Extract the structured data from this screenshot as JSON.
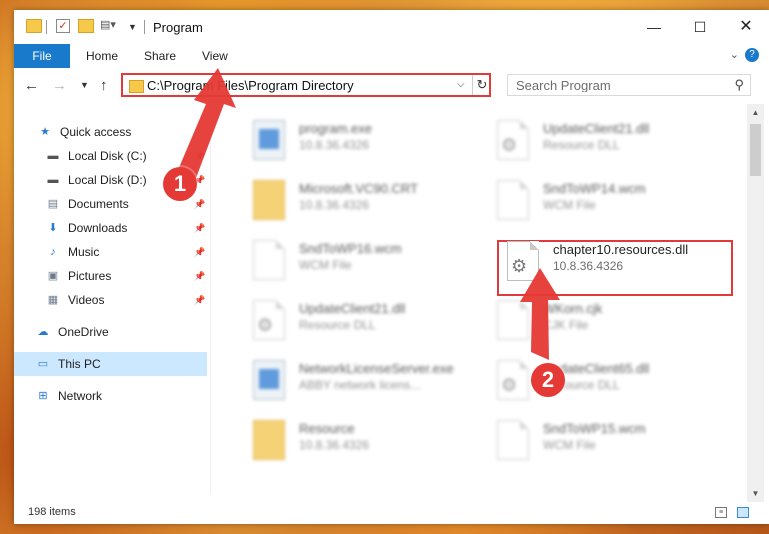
{
  "window": {
    "title": "Program",
    "controls": {
      "minimize": "—",
      "maximize": "☐",
      "close": "✕"
    }
  },
  "ribbon": {
    "tabs": [
      "File",
      "Home",
      "Share",
      "View"
    ],
    "help": "?"
  },
  "navbar": {
    "address": "C:\\Program Files\\Program Directory",
    "search_placeholder": "Search Program"
  },
  "sidebar": {
    "items": [
      {
        "label": "Quick access",
        "icon": "star-icon",
        "pinned": false
      },
      {
        "label": "Local Disk (C:)",
        "icon": "drive-icon",
        "pinned": true
      },
      {
        "label": "Local Disk (D:)",
        "icon": "drive-icon",
        "pinned": true
      },
      {
        "label": "Documents",
        "icon": "documents-icon",
        "pinned": true
      },
      {
        "label": "Downloads",
        "icon": "download-arrow-icon",
        "pinned": true
      },
      {
        "label": "Music",
        "icon": "music-note-icon",
        "pinned": true
      },
      {
        "label": "Pictures",
        "icon": "pictures-icon",
        "pinned": true
      },
      {
        "label": "Videos",
        "icon": "film-icon",
        "pinned": true
      },
      {
        "label": "OneDrive",
        "icon": "cloud-icon",
        "pinned": false
      },
      {
        "label": "This PC",
        "icon": "monitor-icon",
        "pinned": false,
        "selected": true
      },
      {
        "label": "Network",
        "icon": "network-icon",
        "pinned": false
      }
    ]
  },
  "files": [
    {
      "name": "program.exe",
      "meta": "10.8.36.4326",
      "icon": "exe-icon"
    },
    {
      "name": "UpdateClient21.dll",
      "meta": "Resource DLL",
      "icon": "dll-icon"
    },
    {
      "name": "Microsoft.VC90.CRT",
      "meta": "10.8.36.4326",
      "icon": "folder-icon"
    },
    {
      "name": "SndToWP14.wcm",
      "meta": "WCM File",
      "icon": "document-icon"
    },
    {
      "name": "SndToWP16.wcm",
      "meta": "WCM File",
      "icon": "document-icon"
    },
    {
      "name": "chapter10.resources.dll",
      "meta": "10.8.36.4326",
      "icon": "dll-icon",
      "highlighted": true
    },
    {
      "name": "UpdateClient21.dll",
      "meta": "Resource DLL",
      "icon": "dll-icon"
    },
    {
      "name": "WKorn.cjk",
      "meta": "CJK File",
      "icon": "document-icon"
    },
    {
      "name": "NetworkLicenseServer.exe",
      "meta": "ABBY network licens...",
      "icon": "exe-icon"
    },
    {
      "name": "UpdateClient65.dll",
      "meta": "Resource DLL",
      "icon": "dll-icon"
    },
    {
      "name": "Resource",
      "meta": "10.8.36.4326",
      "icon": "folder-icon"
    },
    {
      "name": "SndToWP15.wcm",
      "meta": "WCM File",
      "icon": "document-icon"
    }
  ],
  "status": {
    "count": "198 items"
  },
  "annotations": {
    "step1": "1",
    "step2": "2",
    "color": "#e53935"
  }
}
